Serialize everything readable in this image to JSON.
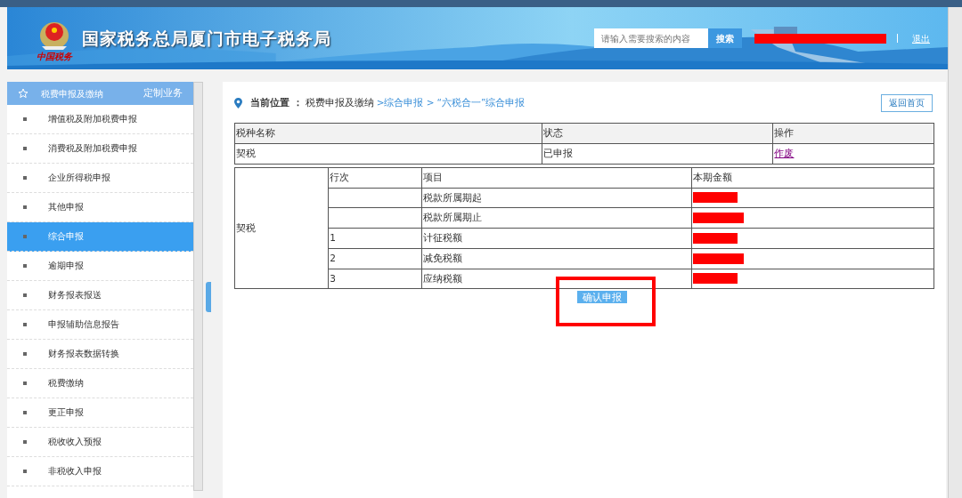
{
  "header": {
    "logo_text": "中国税务",
    "site_title": "国家税务总局厦门市电子税务局",
    "search": {
      "placeholder": "请输入需要搜索的内容",
      "button": "搜索"
    },
    "user_redacted": true,
    "logout": "退出"
  },
  "sidebar": {
    "title": "税费申报及缴纳",
    "customize": "定制业务",
    "items": [
      {
        "label": "增值税及附加税费申报",
        "selected": false
      },
      {
        "label": "消费税及附加税费申报",
        "selected": false
      },
      {
        "label": "企业所得税申报",
        "selected": false
      },
      {
        "label": "其他申报",
        "selected": false
      },
      {
        "label": "综合申报",
        "selected": true
      },
      {
        "label": "逾期申报",
        "selected": false
      },
      {
        "label": "财务报表报送",
        "selected": false
      },
      {
        "label": "申报辅助信息报告",
        "selected": false
      },
      {
        "label": "财务报表数据转换",
        "selected": false
      },
      {
        "label": "税费缴纳",
        "selected": false
      },
      {
        "label": "更正申报",
        "selected": false
      },
      {
        "label": "税收收入预报",
        "selected": false
      },
      {
        "label": "非税收入申报",
        "selected": false
      }
    ]
  },
  "breadcrumb": {
    "label": "当前位置 ：",
    "items": [
      {
        "text": "税费申报及缴纳",
        "link": false
      },
      {
        "text": ">综合申报 >",
        "link": true
      },
      {
        "text": "“六税合一”综合申报",
        "link": true
      }
    ]
  },
  "home_button": "返回首页",
  "summary_table": {
    "columns": [
      "税种名称",
      "状态",
      "操作"
    ],
    "rows": [
      [
        "契税",
        "已申报",
        "作废"
      ]
    ]
  },
  "detail_table": {
    "tax": "契税",
    "columns": [
      "行次",
      "项目",
      "本期金额"
    ],
    "rows": [
      {
        "line": "",
        "item": "税款所属期起",
        "redacted": true
      },
      {
        "line": "",
        "item": "税款所属期止",
        "redacted": true
      },
      {
        "line": "1",
        "item": "计征税额",
        "redacted": true
      },
      {
        "line": "2",
        "item": "减免税额",
        "redacted": true
      },
      {
        "line": "3",
        "item": "应纳税额",
        "redacted": true
      }
    ]
  },
  "confirm_button": {
    "label": "确认申报",
    "highlighted": true
  }
}
